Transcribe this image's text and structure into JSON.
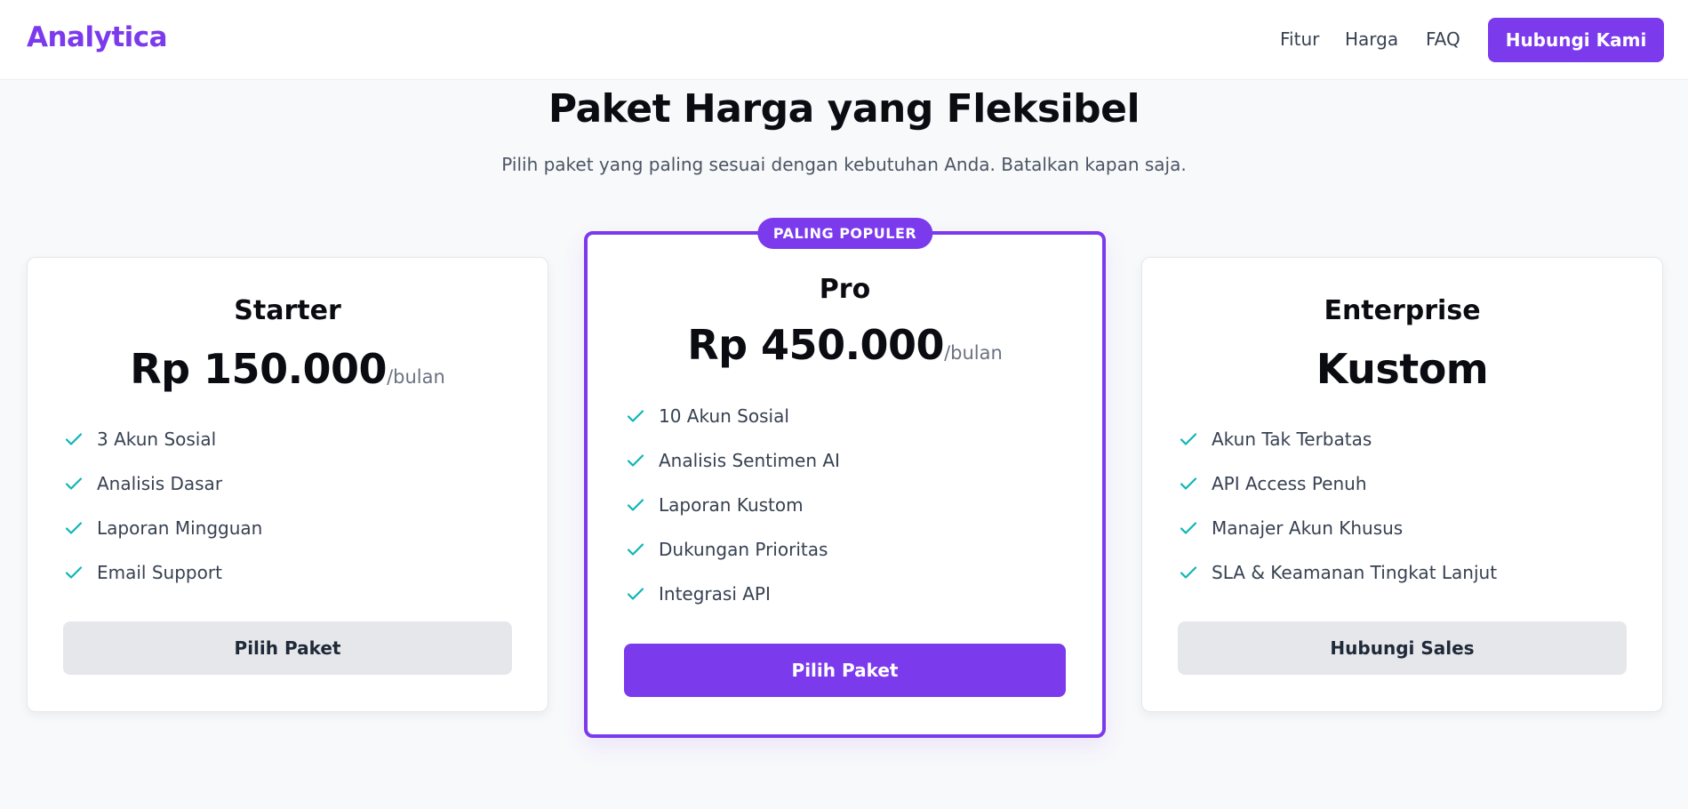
{
  "nav": {
    "logo": "Analytica",
    "links": [
      "Fitur",
      "Harga",
      "FAQ"
    ],
    "cta": "Hubungi Kami"
  },
  "hero": {
    "title": "Paket Harga yang Fleksibel",
    "subtitle": "Pilih paket yang paling sesuai dengan kebutuhan Anda. Batalkan kapan saja."
  },
  "plans": [
    {
      "name": "Starter",
      "price": "Rp 150.000",
      "period": "/bulan",
      "features": [
        "3 Akun Sosial",
        "Analisis Dasar",
        "Laporan Mingguan",
        "Email Support"
      ],
      "button": "Pilih Paket"
    },
    {
      "badge": "PALING POPULER",
      "name": "Pro",
      "price": "Rp 450.000",
      "period": "/bulan",
      "features": [
        "10 Akun Sosial",
        "Analisis Sentimen AI",
        "Laporan Kustom",
        "Dukungan Prioritas",
        "Integrasi API"
      ],
      "button": "Pilih Paket"
    },
    {
      "name": "Enterprise",
      "price": "Kustom",
      "features": [
        "Akun Tak Terbatas",
        "API Access Penuh",
        "Manajer Akun Khusus",
        "SLA & Keamanan Tingkat Lanjut"
      ],
      "button": "Hubungi Sales"
    }
  ],
  "icons": {
    "feature_check": "check-icon"
  },
  "colors": {
    "accent": "#7c3aed",
    "check": "#0eb5b5",
    "text_muted": "#6b7280"
  }
}
